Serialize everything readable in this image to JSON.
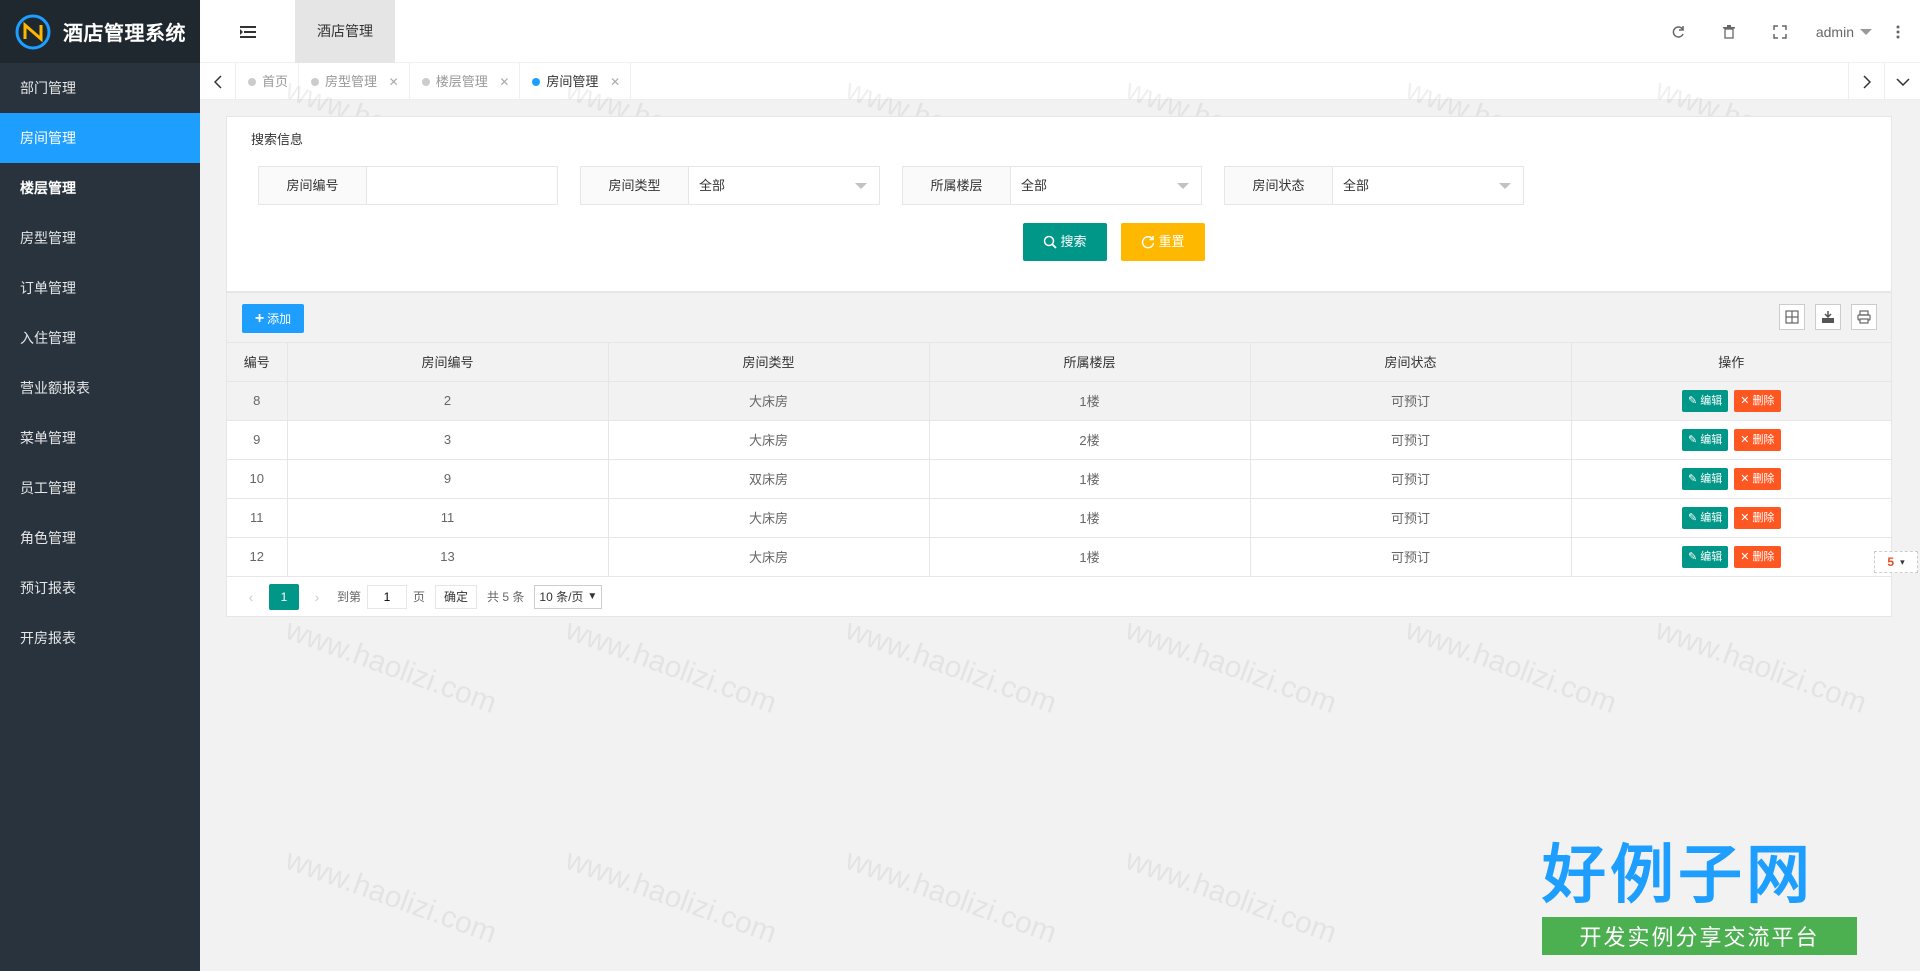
{
  "app": {
    "title": "酒店管理系统"
  },
  "sidebar": {
    "items": [
      {
        "label": "部门管理"
      },
      {
        "label": "房间管理"
      },
      {
        "label": "楼层管理"
      },
      {
        "label": "房型管理"
      },
      {
        "label": "订单管理"
      },
      {
        "label": "入住管理"
      },
      {
        "label": "营业额报表"
      },
      {
        "label": "菜单管理"
      },
      {
        "label": "员工管理"
      },
      {
        "label": "角色管理"
      },
      {
        "label": "预订报表"
      },
      {
        "label": "开房报表"
      }
    ]
  },
  "header": {
    "tab": "酒店管理",
    "user": "admin"
  },
  "tabbar": {
    "tabs": [
      {
        "label": "首页"
      },
      {
        "label": "房型管理"
      },
      {
        "label": "楼层管理"
      },
      {
        "label": "房间管理"
      }
    ]
  },
  "search": {
    "legend": "搜索信息",
    "room_no_label": "房间编号",
    "room_no_value": "",
    "room_type_label": "房间类型",
    "room_type_value": "全部",
    "floor_label": "所属楼层",
    "floor_value": "全部",
    "status_label": "房间状态",
    "status_value": "全部",
    "search_btn": "搜索",
    "reset_btn": "重置"
  },
  "table": {
    "add_btn": "添加",
    "columns": [
      "编号",
      "房间编号",
      "房间类型",
      "所属楼层",
      "房间状态",
      "操作"
    ],
    "rows": [
      {
        "id": "8",
        "room_no": "2",
        "type": "大床房",
        "floor": "1楼",
        "status": "可预订"
      },
      {
        "id": "9",
        "room_no": "3",
        "type": "大床房",
        "floor": "2楼",
        "status": "可预订"
      },
      {
        "id": "10",
        "room_no": "9",
        "type": "双床房",
        "floor": "1楼",
        "status": "可预订"
      },
      {
        "id": "11",
        "room_no": "11",
        "type": "大床房",
        "floor": "1楼",
        "status": "可预订"
      },
      {
        "id": "12",
        "room_no": "13",
        "type": "大床房",
        "floor": "1楼",
        "status": "可预订"
      }
    ],
    "edit_label": "编辑",
    "delete_label": "删除"
  },
  "pager": {
    "current": "1",
    "goto_label": "到第",
    "goto_value": "1",
    "page_unit": "页",
    "ok": "确定",
    "total": "共 5 条",
    "page_size": "10 条/页"
  },
  "watermark": "www.haolizi.com",
  "brand": {
    "big": "好例子网",
    "small": "开发实例分享交流平台"
  },
  "colors": {
    "sidebar": "#28333e",
    "active": "#1e9fff",
    "primary": "#009688",
    "warn": "#ffb800",
    "danger": "#ff5722"
  }
}
